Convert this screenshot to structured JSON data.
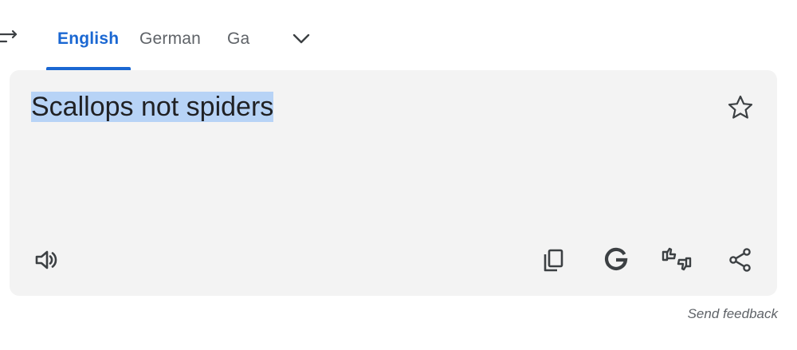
{
  "languages": {
    "tabs": [
      {
        "label": "English",
        "active": true
      },
      {
        "label": "German",
        "active": false
      },
      {
        "label": "Ga",
        "active": false
      }
    ]
  },
  "translation": {
    "text": "Scallops not spiders"
  },
  "actions": {
    "icons": [
      "swap-languages-icon",
      "chevron-down-icon",
      "star-icon",
      "speaker-icon",
      "copy-icon",
      "google-icon",
      "thumbs-rate-icon",
      "share-icon"
    ]
  },
  "footer": {
    "feedback_label": "Send feedback"
  },
  "colors": {
    "accent": "#1a67d2",
    "panel": "#f3f3f3",
    "selection": "#b7d3f6",
    "icon": "#3c4043"
  }
}
